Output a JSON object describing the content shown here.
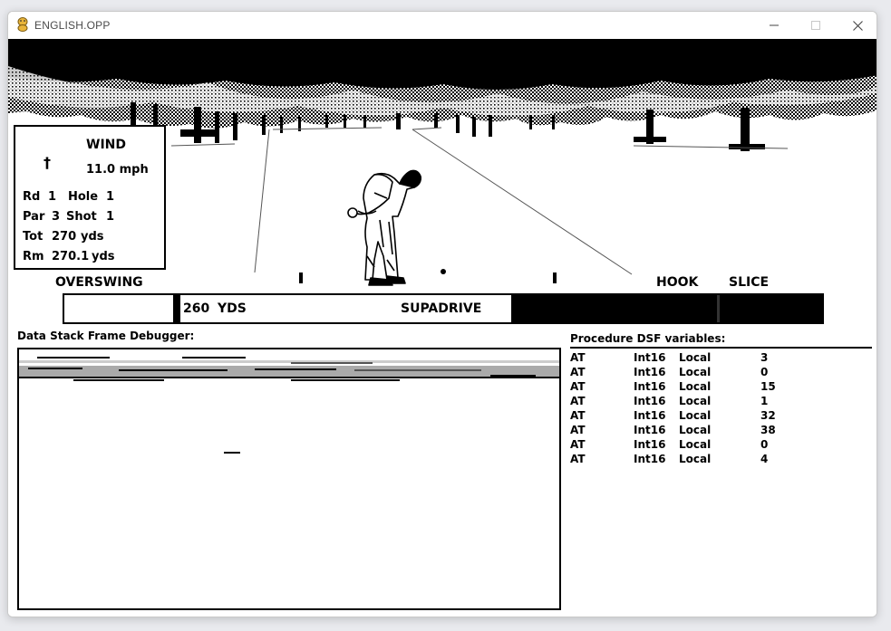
{
  "window": {
    "title": "ENGLISH.OPP",
    "controls": [
      "minimize",
      "maximize",
      "close"
    ]
  },
  "hud": {
    "wind_label": "WIND",
    "wind_arrow": "†",
    "wind_speed": "11.0 mph",
    "rd_label": "Rd",
    "rd_value": "1",
    "hole_label": "Hole",
    "hole_value": "1",
    "par_label": "Par",
    "par_value": "3",
    "shot_label": "Shot",
    "shot_value": "1",
    "tot_label": "Tot",
    "tot_value": "270",
    "tot_unit": "yds",
    "rm_label": "Rm",
    "rm_value": "270.1",
    "rm_unit": "yds"
  },
  "swing": {
    "overswing_label": "OVERSWING",
    "hook_label": "HOOK",
    "slice_label": "SLICE",
    "distance_value": "260",
    "distance_unit": "YDS",
    "club_name": "SUPADRIVE",
    "power_fill_fraction": 0.41
  },
  "debugger": {
    "title": "Data Stack Frame Debugger:"
  },
  "variables": {
    "title": "Procedure DSF variables:",
    "rows": [
      {
        "name": "AT",
        "type": "Int16",
        "scope": "Local",
        "value": "3"
      },
      {
        "name": "AT",
        "type": "Int16",
        "scope": "Local",
        "value": "0"
      },
      {
        "name": "AT",
        "type": "Int16",
        "scope": "Local",
        "value": "15"
      },
      {
        "name": "AT",
        "type": "Int16",
        "scope": "Local",
        "value": "1"
      },
      {
        "name": "AT",
        "type": "Int16",
        "scope": "Local",
        "value": "32"
      },
      {
        "name": "AT",
        "type": "Int16",
        "scope": "Local",
        "value": "38"
      },
      {
        "name": "AT",
        "type": "Int16",
        "scope": "Local",
        "value": "0"
      },
      {
        "name": "AT",
        "type": "Int16",
        "scope": "Local",
        "value": "4"
      }
    ]
  },
  "colors": {
    "ink": "#000000",
    "paper": "#ffffff",
    "window_bg": "#e9eaee"
  }
}
